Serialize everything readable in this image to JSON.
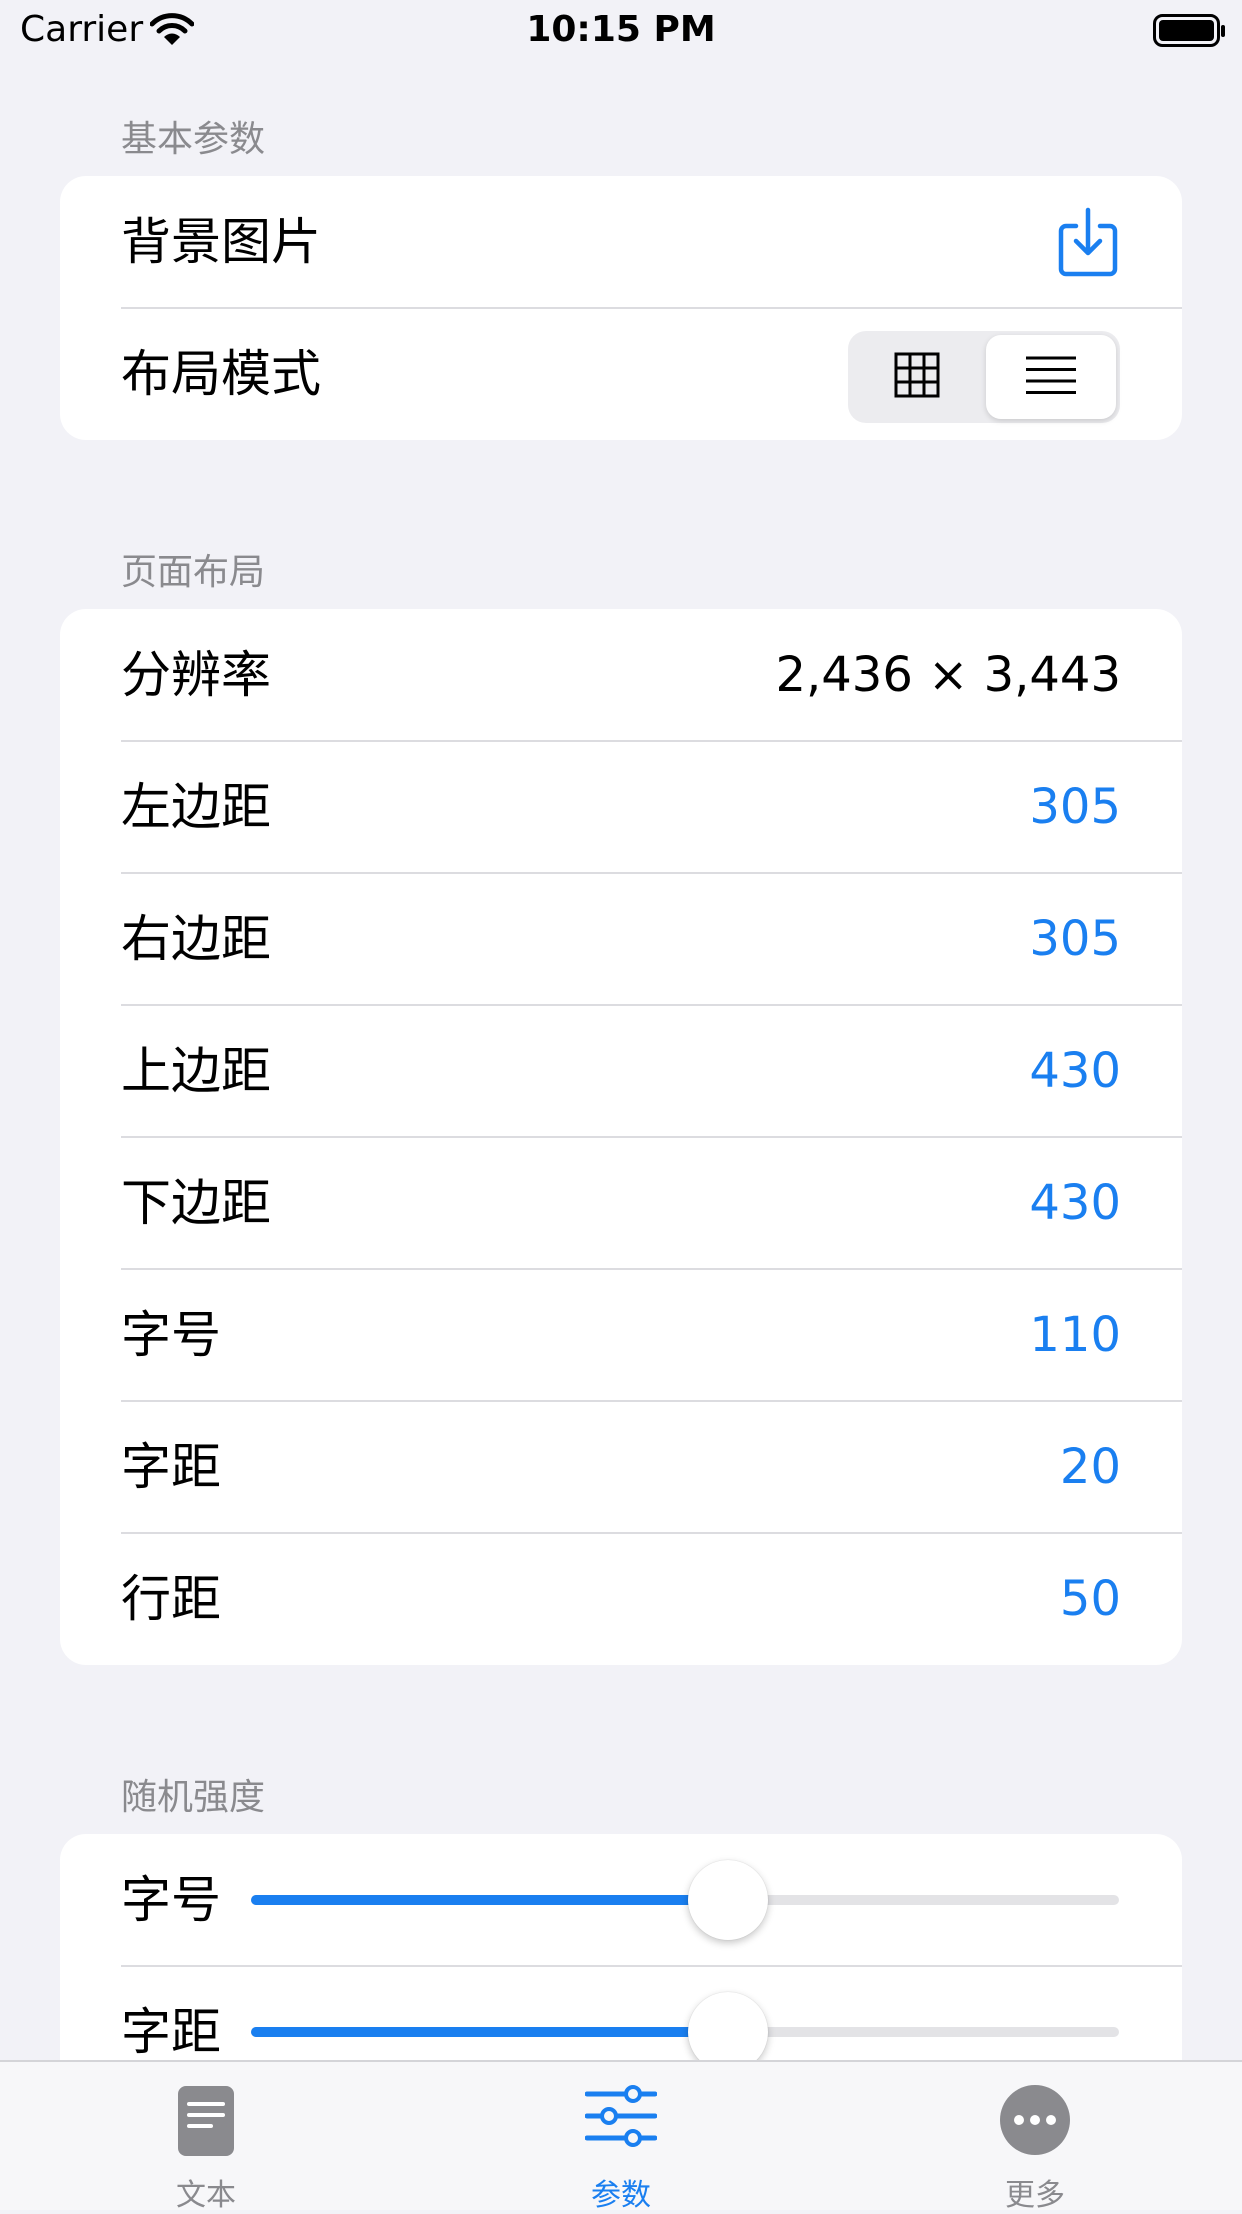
{
  "status_bar": {
    "carrier": "Carrier",
    "time": "10:15 PM"
  },
  "sections": {
    "basic": {
      "header": "基本参数",
      "background_image_label": "背景图片",
      "layout_mode_label": "布局模式",
      "layout_mode_selected": "list"
    },
    "page_layout": {
      "header": "页面布局",
      "rows": [
        {
          "label": "分辨率",
          "value": "2,436 × 3,443"
        },
        {
          "label": "左边距",
          "value": "305"
        },
        {
          "label": "右边距",
          "value": "305"
        },
        {
          "label": "上边距",
          "value": "430"
        },
        {
          "label": "下边距",
          "value": "430"
        },
        {
          "label": "字号",
          "value": "110"
        },
        {
          "label": "字距",
          "value": "20"
        },
        {
          "label": "行距",
          "value": "50"
        }
      ]
    },
    "random_strength": {
      "header": "随机强度",
      "sliders": [
        {
          "label": "字号",
          "value": 0.55
        },
        {
          "label": "字距",
          "value": 0.55
        }
      ]
    }
  },
  "tab_bar": {
    "tabs": [
      {
        "label": "文本",
        "icon": "document-icon",
        "active": false
      },
      {
        "label": "参数",
        "icon": "sliders-icon",
        "active": true
      },
      {
        "label": "更多",
        "icon": "more-icon",
        "active": false
      }
    ]
  },
  "colors": {
    "accent": "#1a7ff0",
    "background": "#f2f2f7"
  }
}
